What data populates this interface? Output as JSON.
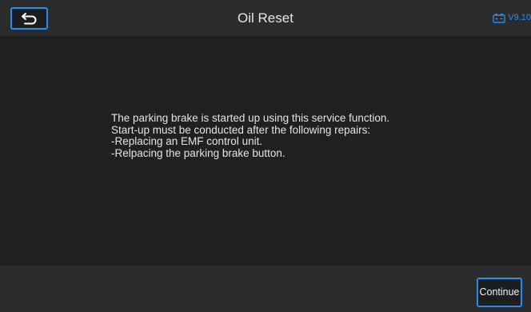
{
  "header": {
    "title": "Oil Reset",
    "version": "V9.10",
    "back_icon": "back-arrow-icon",
    "battery_icon": "battery-icon"
  },
  "main": {
    "message_lines": [
      "The parking brake is started up using this service function.",
      "Start-up must be conducted after the following repairs:",
      "-Replacing an EMF control unit.",
      "-Relpacing the parking brake button."
    ]
  },
  "footer": {
    "continue_label": "Continue"
  },
  "colors": {
    "accent": "#2b8be6",
    "header_bg": "#2a2c2e",
    "content_bg": "#1f2021",
    "text": "#e4e4e4"
  }
}
